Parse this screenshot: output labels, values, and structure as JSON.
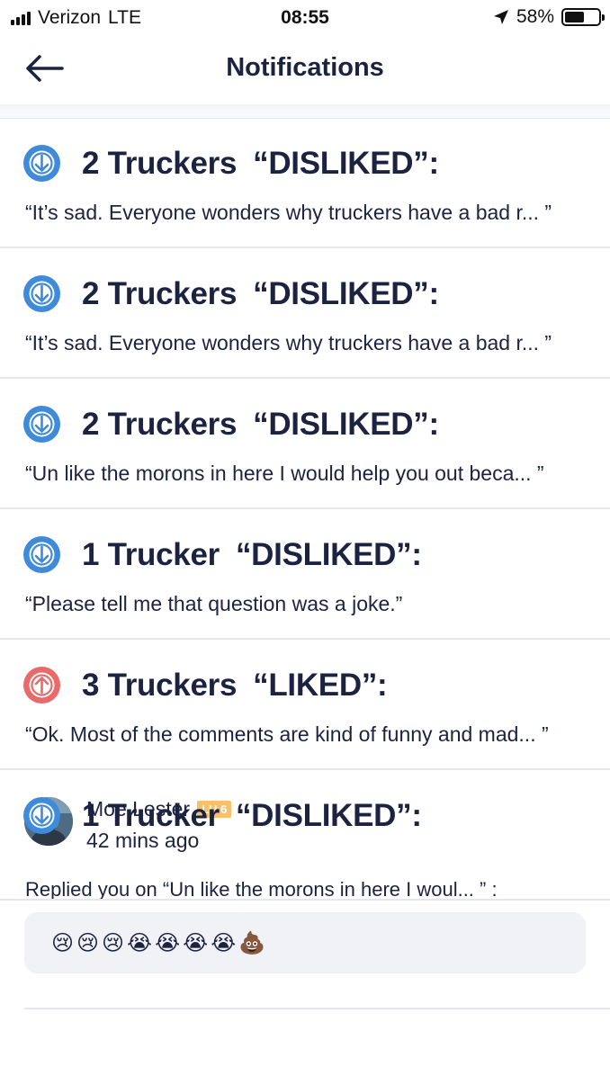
{
  "status_bar": {
    "carrier": "Verizon",
    "network": "LTE",
    "time": "08:55",
    "battery": "58%",
    "battery_level": 0.58
  },
  "header": {
    "title": "Notifications"
  },
  "colors": {
    "dislike": "#3f8ad9",
    "like": "#e86a6a",
    "text": "#1c2340",
    "divider": "#e6e7ec",
    "badge": "#f4c26a"
  },
  "notifications": [
    {
      "count": "2 Truckers",
      "action": "“DISLIKED”:",
      "excerpt": "“It’s sad. Everyone wonders why truckers have a bad r... ”",
      "icon": "thumb-down-arrow-icon"
    },
    {
      "count": "2 Truckers",
      "action": "“DISLIKED”:",
      "excerpt": "“It’s sad. Everyone wonders why truckers have a bad r... ”",
      "icon": "thumb-down-arrow-icon"
    },
    {
      "count": "2 Truckers",
      "action": "“DISLIKED”:",
      "excerpt": "“Un like the morons in here I would help you out beca... ”",
      "icon": "thumb-down-arrow-icon"
    },
    {
      "count": "1 Trucker",
      "action": "“DISLIKED”:",
      "excerpt": "“Please tell me that question was a joke.”",
      "icon": "thumb-down-arrow-icon"
    },
    {
      "count": "3 Truckers",
      "action": "“LIKED”:",
      "excerpt": "“Ok. Most of the comments are kind of funny and mad... ”",
      "icon": "thumb-up-arrow-icon"
    }
  ],
  "reply": {
    "user": "Moe Lester",
    "level": "LU 6",
    "time_ago": "42 mins ago",
    "text": "Replied you on  “Un like the morons in here I woul... ” :",
    "message": "😢😢😢😭😭😭😭💩"
  },
  "last_notification": {
    "count": "1 Trucker",
    "action": "“DISLIKED”:",
    "icon": "thumb-down-arrow-icon"
  }
}
